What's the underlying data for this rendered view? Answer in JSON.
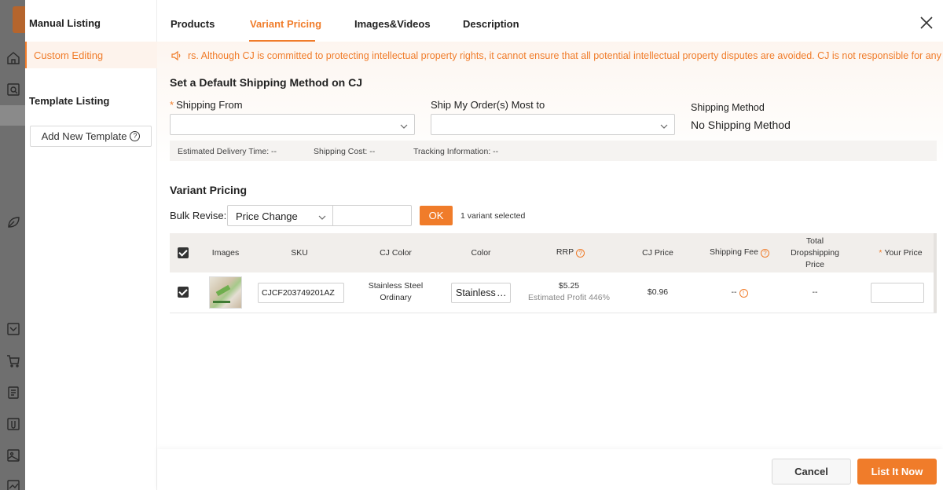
{
  "rail": {
    "icons": [
      "home-icon",
      "search-doc-icon",
      "leaf-icon",
      "mail-icon",
      "cart-icon",
      "clipboard-icon",
      "clip-icon",
      "gallery-icon",
      "chart-icon"
    ]
  },
  "left_panel": {
    "manual_listing_title": "Manual Listing",
    "custom_editing_label": "Custom Editing",
    "template_listing_title": "Template Listing",
    "add_template_label": "Add New Template"
  },
  "tabs": [
    {
      "label": "Products",
      "active": false
    },
    {
      "label": "Variant Pricing",
      "active": true
    },
    {
      "label": "Images&Videos",
      "active": false
    },
    {
      "label": "Description",
      "active": false
    }
  ],
  "notice": {
    "text": "rs. Although CJ is committed to protecting intellectual property rights, it cannot ensure that all potential intellectual property disputes are avoided. CJ is not responsible for any intellectua"
  },
  "shipping": {
    "title": "Set a Default Shipping Method on CJ",
    "from_label": "Shipping From",
    "to_label": "Ship My Order(s) Most to",
    "method_label": "Shipping Method",
    "method_value": "No Shipping Method",
    "delivery_time": "Estimated Delivery Time: --",
    "cost": "Shipping Cost: --",
    "tracking": "Tracking Information: --"
  },
  "variant_pricing": {
    "title": "Variant Pricing",
    "bulk_label": "Bulk Revise:",
    "bulk_option": "Price Change",
    "ok_label": "OK",
    "selected_count": "1 variant selected",
    "columns": {
      "images": "Images",
      "sku": "SKU",
      "cj_color": "CJ Color",
      "color": "Color",
      "rrp": "RRP",
      "cj_price": "CJ Price",
      "shipping_fee": "Shipping Fee",
      "total_1": "Total",
      "total_2": "Dropshipping",
      "total_3": "Price",
      "your_price": "Your Price"
    },
    "rows": [
      {
        "sku": "CJCF203749201AZ",
        "cj_color_1": "Stainless Steel",
        "cj_color_2": "Ordinary",
        "color": "Stainless Steel Ordinary",
        "rrp": "$5.25",
        "profit": "Estimated Profit 446%",
        "cj_price": "$0.96",
        "shipping_fee": "--",
        "total": "--",
        "your_price": ""
      }
    ]
  },
  "footer": {
    "cancel_label": "Cancel",
    "list_label": "List It Now"
  },
  "colors": {
    "accent": "#f07c2a"
  }
}
